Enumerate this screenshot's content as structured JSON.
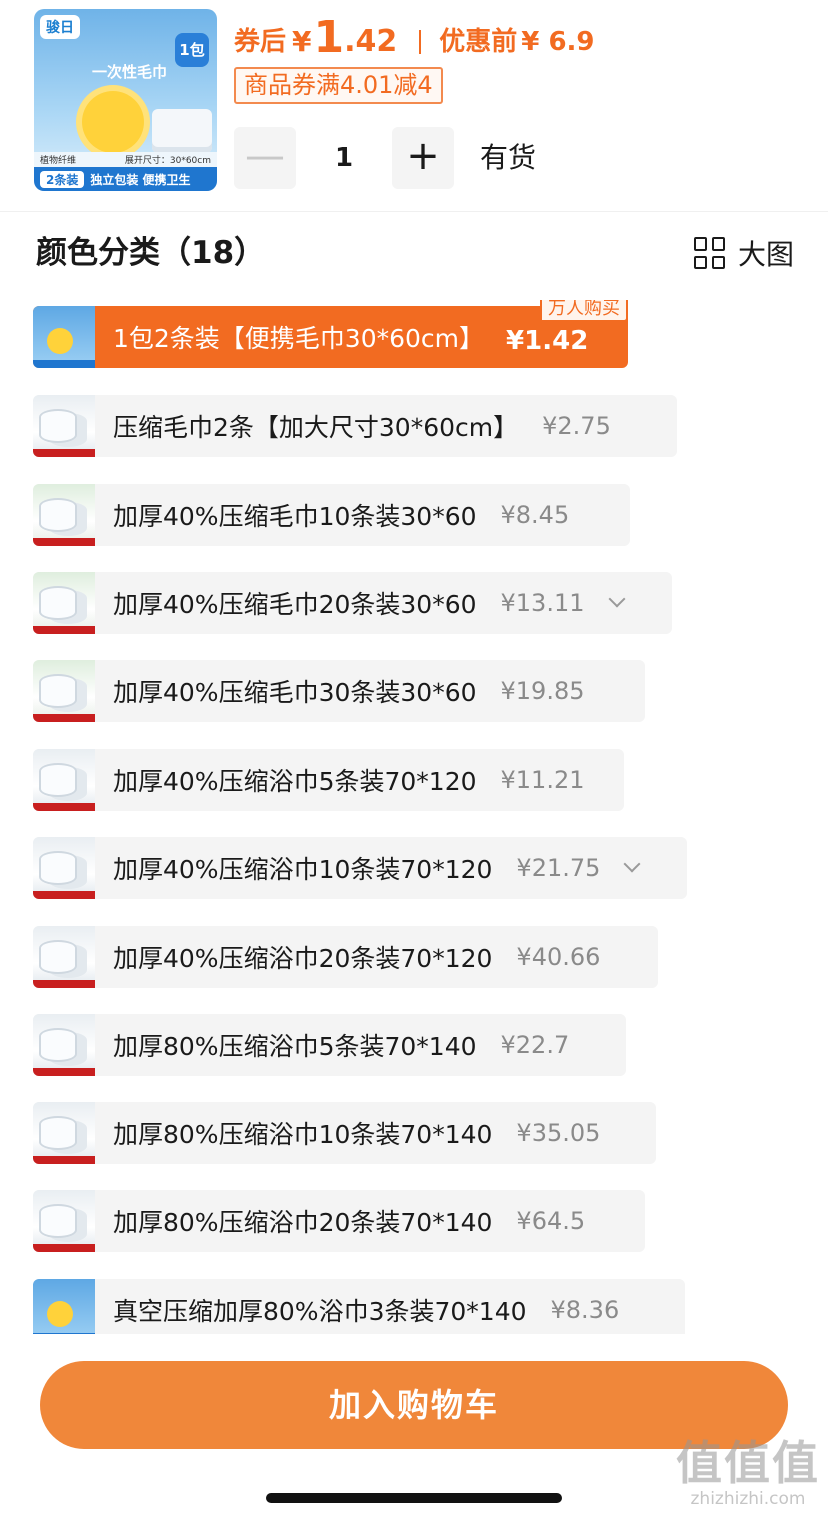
{
  "header": {
    "thumbnail": {
      "brand": "骏日",
      "pack_tag": "1包",
      "title": "一次性毛巾",
      "spec_left": "植物纤维",
      "spec_right": "展开尺寸：30*60cm",
      "count_badge": "2条装",
      "bottom_text": "独立包装 便携卫生"
    },
    "price": {
      "label": "券后",
      "symbol": "¥",
      "integer": "1",
      "decimal": ".42",
      "original_label": "优惠前",
      "original_price": "¥ 6.9"
    },
    "coupon": "商品券满4.01减4",
    "quantity": {
      "minus": "—",
      "value": "1",
      "plus": "+"
    },
    "stock": "有货"
  },
  "section": {
    "title": "颜色分类（18）",
    "big_view_label": "大图",
    "big_view_icon": "grid-icon"
  },
  "options": [
    {
      "name": "1包2条装【便携毛巾30*60cm】",
      "price": "¥1.42",
      "badge": "万人购买",
      "selected": true
    },
    {
      "name": "压缩毛巾2条【加大尺寸30*60cm】",
      "price": "¥2.75"
    },
    {
      "name": "加厚40%压缩毛巾10条装30*60",
      "price": "¥8.45"
    },
    {
      "name": "加厚40%压缩毛巾20条装30*60",
      "price": "¥13.11",
      "dropdown": true
    },
    {
      "name": "加厚40%压缩毛巾30条装30*60",
      "price": "¥19.85"
    },
    {
      "name": "加厚40%压缩浴巾5条装70*120",
      "price": "¥11.21"
    },
    {
      "name": "加厚40%压缩浴巾10条装70*120",
      "price": "¥21.75",
      "dropdown": true
    },
    {
      "name": "加厚40%压缩浴巾20条装70*120",
      "price": "¥40.66"
    },
    {
      "name": "加厚80%压缩浴巾5条装70*140",
      "price": "¥22.7"
    },
    {
      "name": "加厚80%压缩浴巾10条装70*140",
      "price": "¥35.05"
    },
    {
      "name": "加厚80%压缩浴巾20条装70*140",
      "price": "¥64.5"
    },
    {
      "name": "真空压缩加厚80%浴巾3条装70*140",
      "price": "¥8.36"
    }
  ],
  "footer": {
    "add_to_cart": "加入购物车"
  },
  "watermark": {
    "main": "值值值",
    "url": "zhizhizhi.com"
  },
  "colors": {
    "accent": "#f26b21",
    "cart_button": "#f0873a",
    "option_bg": "#f4f4f4",
    "price_gray": "#8a8a8a"
  }
}
